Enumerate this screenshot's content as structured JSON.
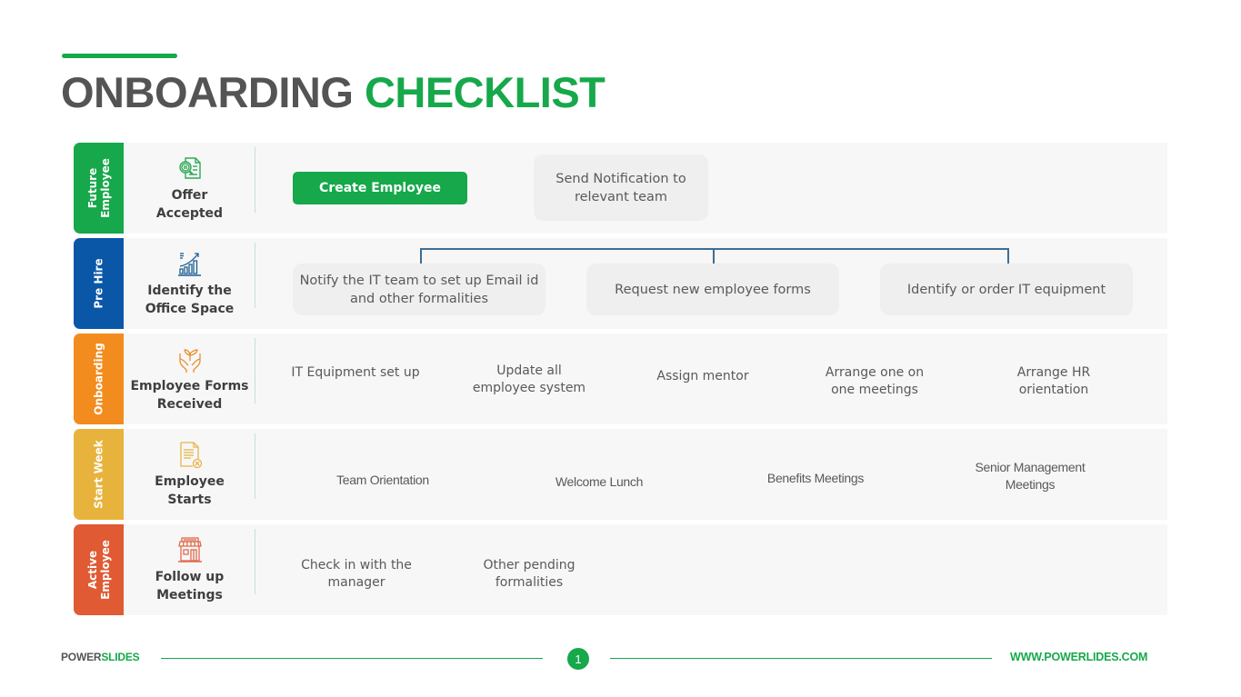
{
  "title": {
    "part1": "ONBOARDING",
    "part2": "CHECKLIST"
  },
  "colors": {
    "green": "#16a84a",
    "blue": "#0a57a8",
    "orange": "#f28c1e",
    "yellow": "#e8b33c",
    "red": "#e05a33",
    "connector": "#3e6d93"
  },
  "rows": [
    {
      "stage": "Future\nEmployee",
      "stage_color": "#16a84a",
      "icon": "document-search-icon",
      "milestone": "Offer\nAccepted",
      "tasks": [
        "Create Employee",
        "Send Notification to\nrelevant team"
      ]
    },
    {
      "stage": "Pre Hire",
      "stage_color": "#0a57a8",
      "icon": "growth-chart-icon",
      "milestone": "Identify the\nOffice Space",
      "tasks": [
        "Notify the IT team to set up Email id\nand other formalities",
        "Request new employee forms",
        "Identify or order IT equipment"
      ]
    },
    {
      "stage": "Onboarding",
      "stage_color": "#f28c1e",
      "icon": "hands-plant-icon",
      "milestone": "Employee Forms\nReceived",
      "tasks": [
        "IT Equipment set up",
        "Update all\nemployee system",
        "Assign mentor",
        "Arrange one on\none meetings",
        "Arrange HR\norientation"
      ]
    },
    {
      "stage": "Start Week",
      "stage_color": "#e8b33c",
      "icon": "document-cancel-icon",
      "milestone": "Employee\nStarts",
      "tasks": [
        "Team Orientation",
        "Welcome Lunch",
        "Benefits Meetings",
        "Senior Management\nMeetings"
      ]
    },
    {
      "stage": "Active\nEmployee",
      "stage_color": "#e05a33",
      "icon": "storefront-icon",
      "milestone": "Follow up\nMeetings",
      "tasks": [
        "Check in with the\nmanager",
        "Other pending\nformalities"
      ]
    }
  ],
  "footer": {
    "brand_part1": "POWER",
    "brand_part2": "SLIDES",
    "page_number": "1",
    "url": "WWW.POWERLIDES.COM"
  }
}
